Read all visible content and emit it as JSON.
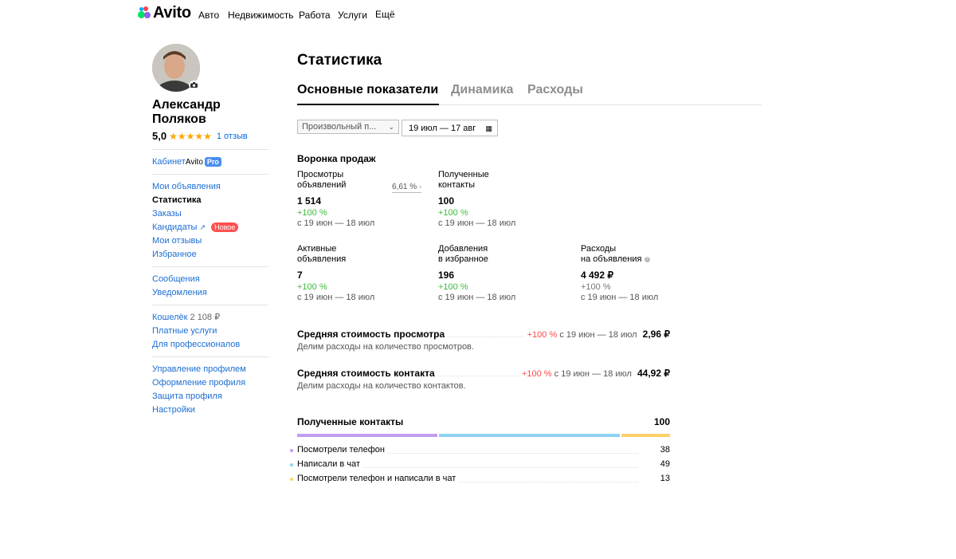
{
  "header": {
    "logo": "Avito",
    "nav": [
      "Авто",
      "Недвижимость",
      "Работа",
      "Услуги",
      "Ещё"
    ]
  },
  "profile": {
    "name": "Александр Поляков",
    "rating": "5,0",
    "stars": "★★★★★",
    "reviews": "1 отзыв"
  },
  "sidebar": {
    "cabinet_label": "Кабинет",
    "cabinet_brand": "Avito",
    "cabinet_badge": "Pro",
    "group1": [
      "Мои объявления",
      "Статистика",
      "Заказы",
      "Кандидаты",
      "Мои отзывы",
      "Избранное"
    ],
    "candidates_badge": "Новое",
    "external_arrow": "↗",
    "group2": [
      "Сообщения",
      "Уведомления"
    ],
    "wallet_label": "Кошелёк",
    "wallet_value": "2 108 ₽",
    "group3": [
      "Платные услуги",
      "Для профессионалов"
    ],
    "group4": [
      "Управление профилем",
      "Оформление профиля",
      "Защита профиля",
      "Настройки"
    ]
  },
  "main": {
    "title": "Статистика",
    "tabs": [
      "Основные показатели",
      "Динамика",
      "Расходы"
    ],
    "period_select": "Произвольный п...",
    "date_range": "19 июл — 17 авг",
    "funnel_title": "Воронка продаж",
    "conversion": "6,61 %",
    "period_text": "с 19 июн — 18 июл",
    "metrics": [
      {
        "label1": "Просмотры",
        "label2": "объявлений",
        "value": "1 514",
        "change": "+100 %"
      },
      {
        "label1": "Полученные",
        "label2": "контакты",
        "value": "100",
        "change": "+100 %"
      },
      {
        "label1": "Активные",
        "label2": "объявления",
        "value": "7",
        "change": "+100 %"
      },
      {
        "label1": "Добавления",
        "label2": "в избранное",
        "value": "196",
        "change": "+100 %"
      },
      {
        "label1": "Расходы",
        "label2": "на объявления",
        "value": "4 492 ₽",
        "change": "+100 %"
      }
    ],
    "costs": [
      {
        "title": "Средняя стоимость просмотра",
        "subtitle": "Делим расходы на количество просмотров.",
        "change": "+100 %",
        "period": "с 19 июн — 18 июл",
        "value": "2,96 ₽"
      },
      {
        "title": "Средняя стоимость контакта",
        "subtitle": "Делим расходы на количество контактов.",
        "change": "+100 %",
        "period": "с 19 июн — 18 июл",
        "value": "44,92 ₽"
      }
    ],
    "contacts": {
      "title": "Полученные контакты",
      "total": "100",
      "items": [
        {
          "label": "Посмотрели телефон",
          "value": "38",
          "share": 0.38,
          "color": "#c29cf0"
        },
        {
          "label": "Написали в чат",
          "value": "49",
          "share": 0.49,
          "color": "#8fd0f5"
        },
        {
          "label": "Посмотрели телефон и написали в чат",
          "value": "13",
          "share": 0.13,
          "color": "#ffd06a"
        }
      ]
    }
  }
}
